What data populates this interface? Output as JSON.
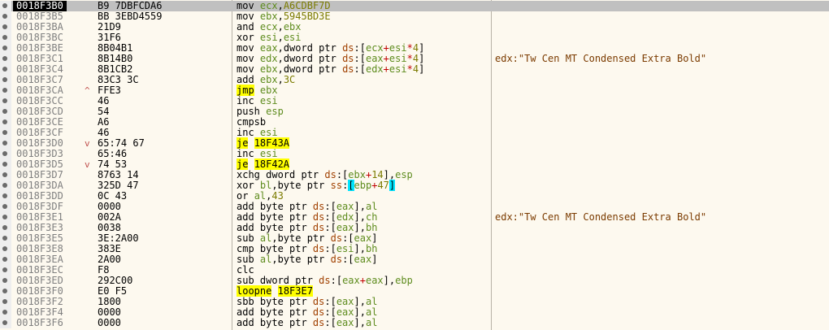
{
  "rows": [
    {
      "addr": "0018F3B0",
      "bytes": "B9 7DBFCDA6",
      "arrow": "",
      "instr": [
        {
          "t": "mov ",
          "c": "k"
        },
        {
          "t": "ecx",
          "c": "r"
        },
        {
          "t": ",",
          "c": "k"
        },
        {
          "t": "A6CDBF7D",
          "c": "imm"
        }
      ],
      "comment": ""
    },
    {
      "addr": "0018F3B5",
      "bytes": "BB 3EBD4559",
      "arrow": "",
      "instr": [
        {
          "t": "mov ",
          "c": "k"
        },
        {
          "t": "ebx",
          "c": "r"
        },
        {
          "t": ",",
          "c": "k"
        },
        {
          "t": "5945BD3E",
          "c": "imm"
        }
      ],
      "comment": ""
    },
    {
      "addr": "0018F3BA",
      "bytes": "21D9",
      "arrow": "",
      "instr": [
        {
          "t": "and ",
          "c": "k"
        },
        {
          "t": "ecx",
          "c": "r"
        },
        {
          "t": ",",
          "c": "k"
        },
        {
          "t": "ebx",
          "c": "r"
        }
      ],
      "comment": ""
    },
    {
      "addr": "0018F3BC",
      "bytes": "31F6",
      "arrow": "",
      "instr": [
        {
          "t": "xor ",
          "c": "k"
        },
        {
          "t": "esi",
          "c": "r"
        },
        {
          "t": ",",
          "c": "k"
        },
        {
          "t": "esi",
          "c": "r"
        }
      ],
      "comment": ""
    },
    {
      "addr": "0018F3BE",
      "bytes": "8B04B1",
      "arrow": "",
      "instr": [
        {
          "t": "mov ",
          "c": "k"
        },
        {
          "t": "eax",
          "c": "r"
        },
        {
          "t": ",dword ptr ",
          "c": "k"
        },
        {
          "t": "ds",
          "c": "seg"
        },
        {
          "t": ":[",
          "c": "k"
        },
        {
          "t": "ecx",
          "c": "r"
        },
        {
          "t": "+",
          "c": "op"
        },
        {
          "t": "esi",
          "c": "r"
        },
        {
          "t": "*",
          "c": "op"
        },
        {
          "t": "4",
          "c": "imm"
        },
        {
          "t": "]",
          "c": "k"
        }
      ],
      "comment": ""
    },
    {
      "addr": "0018F3C1",
      "bytes": "8B14B0",
      "arrow": "",
      "instr": [
        {
          "t": "mov ",
          "c": "k"
        },
        {
          "t": "edx",
          "c": "r"
        },
        {
          "t": ",dword ptr ",
          "c": "k"
        },
        {
          "t": "ds",
          "c": "seg"
        },
        {
          "t": ":[",
          "c": "k"
        },
        {
          "t": "eax",
          "c": "r"
        },
        {
          "t": "+",
          "c": "op"
        },
        {
          "t": "esi",
          "c": "r"
        },
        {
          "t": "*",
          "c": "op"
        },
        {
          "t": "4",
          "c": "imm"
        },
        {
          "t": "]",
          "c": "k"
        }
      ],
      "comment": "edx:\"Tw Cen MT Condensed Extra Bold\""
    },
    {
      "addr": "0018F3C4",
      "bytes": "8B1CB2",
      "arrow": "",
      "instr": [
        {
          "t": "mov ",
          "c": "k"
        },
        {
          "t": "ebx",
          "c": "r"
        },
        {
          "t": ",dword ptr ",
          "c": "k"
        },
        {
          "t": "ds",
          "c": "seg"
        },
        {
          "t": ":[",
          "c": "k"
        },
        {
          "t": "edx",
          "c": "r"
        },
        {
          "t": "+",
          "c": "op"
        },
        {
          "t": "esi",
          "c": "r"
        },
        {
          "t": "*",
          "c": "op"
        },
        {
          "t": "4",
          "c": "imm"
        },
        {
          "t": "]",
          "c": "k"
        }
      ],
      "comment": ""
    },
    {
      "addr": "0018F3C7",
      "bytes": "83C3 3C",
      "arrow": "",
      "instr": [
        {
          "t": "add ",
          "c": "k"
        },
        {
          "t": "ebx",
          "c": "r"
        },
        {
          "t": ",",
          "c": "k"
        },
        {
          "t": "3C",
          "c": "imm"
        }
      ],
      "comment": ""
    },
    {
      "addr": "0018F3CA",
      "bytes": "FFE3",
      "arrow": "^",
      "instr": [
        {
          "t": "jmp",
          "c": "hl"
        },
        {
          "t": " ",
          "c": "k"
        },
        {
          "t": "ebx",
          "c": "r"
        }
      ],
      "comment": ""
    },
    {
      "addr": "0018F3CC",
      "bytes": "46",
      "arrow": "",
      "instr": [
        {
          "t": "inc ",
          "c": "k"
        },
        {
          "t": "esi",
          "c": "r"
        }
      ],
      "comment": ""
    },
    {
      "addr": "0018F3CD",
      "bytes": "54",
      "arrow": "",
      "instr": [
        {
          "t": "push ",
          "c": "k"
        },
        {
          "t": "esp",
          "c": "r"
        }
      ],
      "comment": ""
    },
    {
      "addr": "0018F3CE",
      "bytes": "A6",
      "arrow": "",
      "instr": [
        {
          "t": "cmpsb",
          "c": "k"
        }
      ],
      "comment": ""
    },
    {
      "addr": "0018F3CF",
      "bytes": "46",
      "arrow": "",
      "instr": [
        {
          "t": "inc ",
          "c": "k"
        },
        {
          "t": "esi",
          "c": "r"
        }
      ],
      "comment": ""
    },
    {
      "addr": "0018F3D0",
      "bytes": "65:74 67",
      "arrow": "v",
      "instr": [
        {
          "t": "je",
          "c": "hl"
        },
        {
          "t": " ",
          "c": "k"
        },
        {
          "t": "18F43A",
          "c": "hl"
        }
      ],
      "comment": ""
    },
    {
      "addr": "0018F3D3",
      "bytes": "65:46",
      "arrow": "",
      "instr": [
        {
          "t": "inc ",
          "c": "k"
        },
        {
          "t": "esi",
          "c": "r"
        }
      ],
      "comment": ""
    },
    {
      "addr": "0018F3D5",
      "bytes": "74 53",
      "arrow": "v",
      "instr": [
        {
          "t": "je",
          "c": "hl"
        },
        {
          "t": " ",
          "c": "k"
        },
        {
          "t": "18F42A",
          "c": "hl"
        }
      ],
      "comment": ""
    },
    {
      "addr": "0018F3D7",
      "bytes": "8763 14",
      "arrow": "",
      "instr": [
        {
          "t": "xchg dword ptr ",
          "c": "k"
        },
        {
          "t": "ds",
          "c": "seg"
        },
        {
          "t": ":[",
          "c": "k"
        },
        {
          "t": "ebx",
          "c": "r"
        },
        {
          "t": "+",
          "c": "op"
        },
        {
          "t": "14",
          "c": "imm"
        },
        {
          "t": "],",
          "c": "k"
        },
        {
          "t": "esp",
          "c": "r"
        }
      ],
      "comment": ""
    },
    {
      "addr": "0018F3DA",
      "bytes": "325D 47",
      "arrow": "",
      "instr": [
        {
          "t": "xor ",
          "c": "k"
        },
        {
          "t": "bl",
          "c": "r"
        },
        {
          "t": ",byte ptr ",
          "c": "k"
        },
        {
          "t": "ss",
          "c": "seg"
        },
        {
          "t": ":",
          "c": "k"
        },
        {
          "t": "[",
          "c": "cyan"
        },
        {
          "t": "ebp",
          "c": "r"
        },
        {
          "t": "+",
          "c": "op"
        },
        {
          "t": "47",
          "c": "imm"
        },
        {
          "t": "]",
          "c": "cyan"
        }
      ],
      "comment": ""
    },
    {
      "addr": "0018F3DD",
      "bytes": "0C 43",
      "arrow": "",
      "instr": [
        {
          "t": "or ",
          "c": "k"
        },
        {
          "t": "al",
          "c": "r"
        },
        {
          "t": ",",
          "c": "k"
        },
        {
          "t": "43",
          "c": "imm"
        }
      ],
      "comment": ""
    },
    {
      "addr": "0018F3DF",
      "bytes": "0000",
      "arrow": "",
      "instr": [
        {
          "t": "add byte ptr ",
          "c": "k"
        },
        {
          "t": "ds",
          "c": "seg"
        },
        {
          "t": ":[",
          "c": "k"
        },
        {
          "t": "eax",
          "c": "r"
        },
        {
          "t": "],",
          "c": "k"
        },
        {
          "t": "al",
          "c": "r"
        }
      ],
      "comment": ""
    },
    {
      "addr": "0018F3E1",
      "bytes": "002A",
      "arrow": "",
      "instr": [
        {
          "t": "add byte ptr ",
          "c": "k"
        },
        {
          "t": "ds",
          "c": "seg"
        },
        {
          "t": ":[",
          "c": "k"
        },
        {
          "t": "edx",
          "c": "r"
        },
        {
          "t": "],",
          "c": "k"
        },
        {
          "t": "ch",
          "c": "r"
        }
      ],
      "comment": "edx:\"Tw Cen MT Condensed Extra Bold\""
    },
    {
      "addr": "0018F3E3",
      "bytes": "0038",
      "arrow": "",
      "instr": [
        {
          "t": "add byte ptr ",
          "c": "k"
        },
        {
          "t": "ds",
          "c": "seg"
        },
        {
          "t": ":[",
          "c": "k"
        },
        {
          "t": "eax",
          "c": "r"
        },
        {
          "t": "],",
          "c": "k"
        },
        {
          "t": "bh",
          "c": "r"
        }
      ],
      "comment": ""
    },
    {
      "addr": "0018F3E5",
      "bytes": "3E:2A00",
      "arrow": "",
      "instr": [
        {
          "t": "sub ",
          "c": "k"
        },
        {
          "t": "al",
          "c": "r"
        },
        {
          "t": ",byte ptr ",
          "c": "k"
        },
        {
          "t": "ds",
          "c": "seg"
        },
        {
          "t": ":[",
          "c": "k"
        },
        {
          "t": "eax",
          "c": "r"
        },
        {
          "t": "]",
          "c": "k"
        }
      ],
      "comment": ""
    },
    {
      "addr": "0018F3E8",
      "bytes": "383E",
      "arrow": "",
      "instr": [
        {
          "t": "cmp byte ptr ",
          "c": "k"
        },
        {
          "t": "ds",
          "c": "seg"
        },
        {
          "t": ":[",
          "c": "k"
        },
        {
          "t": "esi",
          "c": "r"
        },
        {
          "t": "],",
          "c": "k"
        },
        {
          "t": "bh",
          "c": "r"
        }
      ],
      "comment": ""
    },
    {
      "addr": "0018F3EA",
      "bytes": "2A00",
      "arrow": "",
      "instr": [
        {
          "t": "sub ",
          "c": "k"
        },
        {
          "t": "al",
          "c": "r"
        },
        {
          "t": ",byte ptr ",
          "c": "k"
        },
        {
          "t": "ds",
          "c": "seg"
        },
        {
          "t": ":[",
          "c": "k"
        },
        {
          "t": "eax",
          "c": "r"
        },
        {
          "t": "]",
          "c": "k"
        }
      ],
      "comment": ""
    },
    {
      "addr": "0018F3EC",
      "bytes": "F8",
      "arrow": "",
      "instr": [
        {
          "t": "clc",
          "c": "k"
        }
      ],
      "comment": ""
    },
    {
      "addr": "0018F3ED",
      "bytes": "292C00",
      "arrow": "",
      "instr": [
        {
          "t": "sub dword ptr ",
          "c": "k"
        },
        {
          "t": "ds",
          "c": "seg"
        },
        {
          "t": ":[",
          "c": "k"
        },
        {
          "t": "eax",
          "c": "r"
        },
        {
          "t": "+",
          "c": "op"
        },
        {
          "t": "eax",
          "c": "r"
        },
        {
          "t": "],",
          "c": "k"
        },
        {
          "t": "ebp",
          "c": "r"
        }
      ],
      "comment": ""
    },
    {
      "addr": "0018F3F0",
      "bytes": "E0 F5",
      "arrow": "",
      "instr": [
        {
          "t": "loopne",
          "c": "hl"
        },
        {
          "t": " ",
          "c": "k"
        },
        {
          "t": "18F3E7",
          "c": "hl"
        }
      ],
      "comment": ""
    },
    {
      "addr": "0018F3F2",
      "bytes": "1800",
      "arrow": "",
      "instr": [
        {
          "t": "sbb byte ptr ",
          "c": "k"
        },
        {
          "t": "ds",
          "c": "seg"
        },
        {
          "t": ":[",
          "c": "k"
        },
        {
          "t": "eax",
          "c": "r"
        },
        {
          "t": "],",
          "c": "k"
        },
        {
          "t": "al",
          "c": "r"
        }
      ],
      "comment": ""
    },
    {
      "addr": "0018F3F4",
      "bytes": "0000",
      "arrow": "",
      "instr": [
        {
          "t": "add byte ptr ",
          "c": "k"
        },
        {
          "t": "ds",
          "c": "seg"
        },
        {
          "t": ":[",
          "c": "k"
        },
        {
          "t": "eax",
          "c": "r"
        },
        {
          "t": "],",
          "c": "k"
        },
        {
          "t": "al",
          "c": "r"
        }
      ],
      "comment": ""
    },
    {
      "addr": "0018F3F6",
      "bytes": "0000",
      "arrow": "",
      "instr": [
        {
          "t": "add byte ptr ",
          "c": "k"
        },
        {
          "t": "ds",
          "c": "seg"
        },
        {
          "t": ":[",
          "c": "k"
        },
        {
          "t": "eax",
          "c": "r"
        },
        {
          "t": "],",
          "c": "k"
        },
        {
          "t": "al",
          "c": "r"
        }
      ],
      "comment": ""
    }
  ],
  "colors": {
    "background": "#fdf9ef",
    "selected_row": "#c0c0c0",
    "address_highlight": "#000000",
    "jump_highlight": "#ffff00",
    "bracket_highlight": "#00e5ff",
    "register": "#5e8c1e",
    "segment": "#a04000",
    "immediate": "#7b7b00",
    "comment": "#7b3b00"
  },
  "icons": {
    "row_marker": "breakpoint-dot-icon",
    "jump_up": "arrow-up-icon",
    "jump_down": "arrow-down-icon"
  }
}
